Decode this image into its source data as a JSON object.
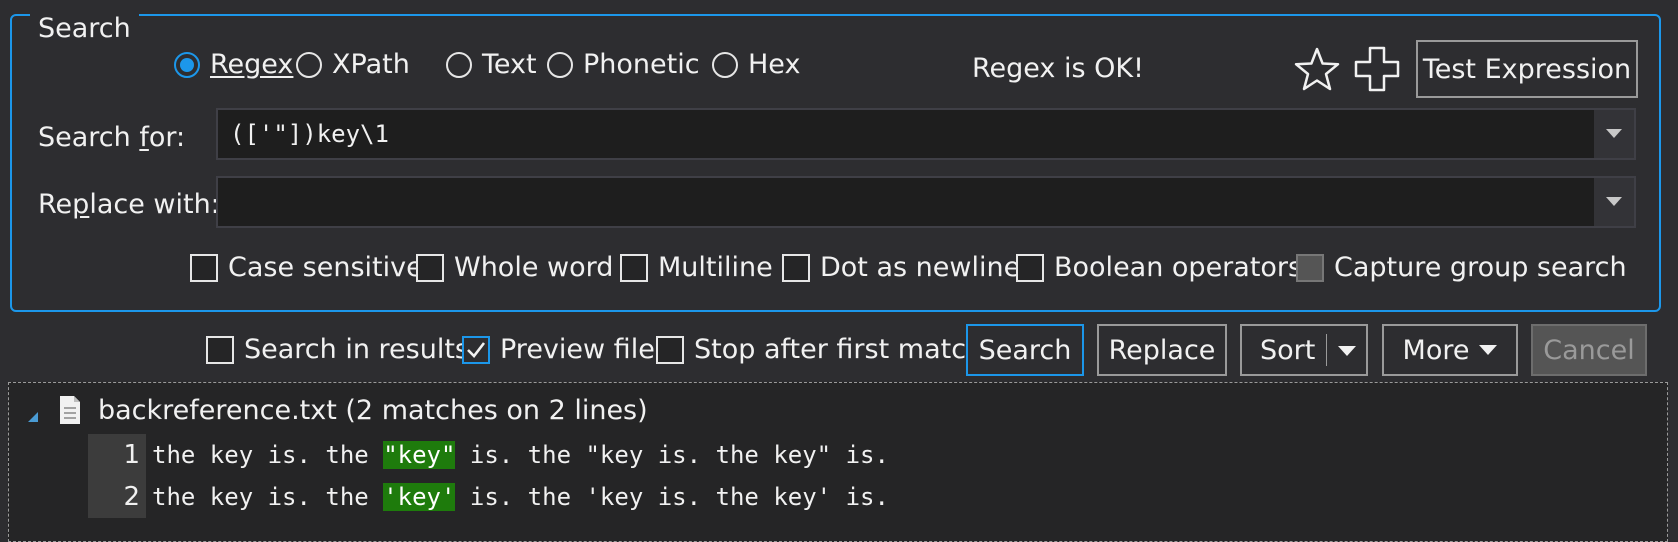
{
  "search_group": {
    "legend": "Search"
  },
  "modes": [
    {
      "label": "Regex",
      "selected": true
    },
    {
      "label": "XPath",
      "selected": false
    },
    {
      "label": "Text",
      "selected": false
    },
    {
      "label": "Phonetic",
      "selected": false
    },
    {
      "label": "Hex",
      "selected": false
    }
  ],
  "status": "Regex is OK!",
  "test_expression_label": "Test Expression",
  "search_for": {
    "label": "Search for:",
    "value": "(['\"])key\\1"
  },
  "replace_with": {
    "label": "Replace with:",
    "value": ""
  },
  "options": [
    {
      "label": "Case sensitive",
      "checked": false
    },
    {
      "label": "Whole word",
      "checked": false
    },
    {
      "label": "Multiline",
      "checked": false
    },
    {
      "label": "Dot as newline",
      "checked": false
    },
    {
      "label": "Boolean operators",
      "checked": false
    },
    {
      "label": "Capture group search",
      "checked": false,
      "disabled": true
    }
  ],
  "bottom_options": [
    {
      "label": "Search in results",
      "checked": false
    },
    {
      "label": "Preview file",
      "checked": true
    },
    {
      "label": "Stop after first match",
      "checked": false
    }
  ],
  "buttons": {
    "search": "Search",
    "replace": "Replace",
    "sort": "Sort",
    "more": "More",
    "cancel": "Cancel"
  },
  "results": {
    "file": "backreference.txt (2 matches on 2 lines)",
    "lines": [
      {
        "num": "1",
        "pre": "the key is. the ",
        "match": "\"key\"",
        "post": " is. the \"key is. the key\" is."
      },
      {
        "num": "2",
        "pre": "the key is. the ",
        "match": "'key'",
        "post": " is. the 'key is. the key' is."
      }
    ]
  },
  "colors": {
    "accent": "#1c97ea",
    "match_highlight": "#1e7b0c",
    "background": "#2d2d30"
  }
}
